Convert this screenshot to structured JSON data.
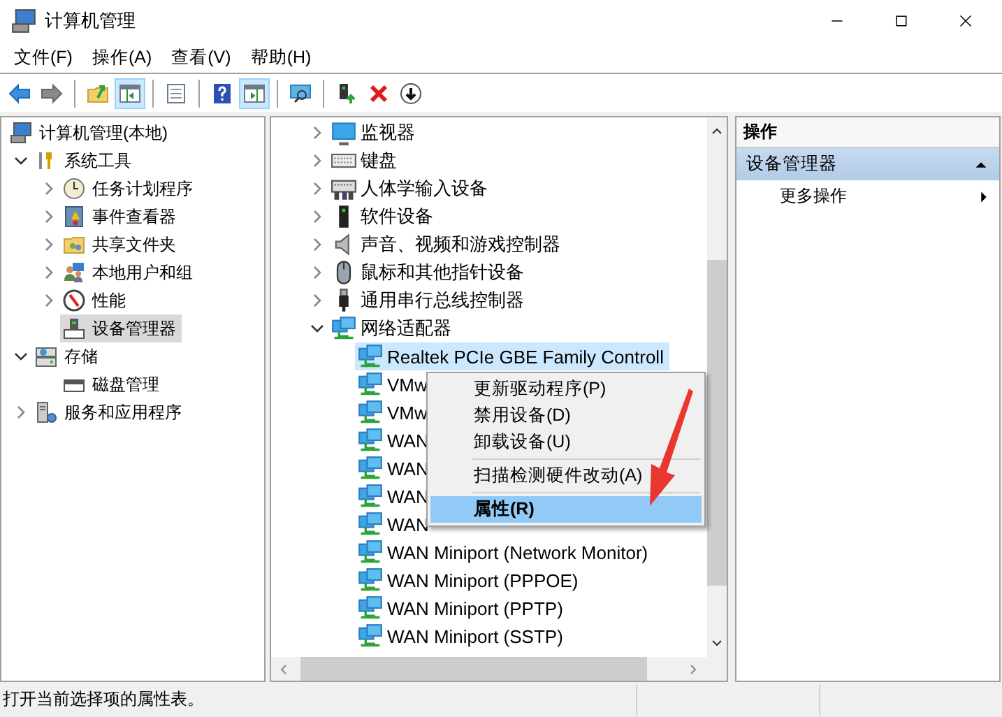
{
  "window": {
    "title": "计算机管理"
  },
  "menu_bar": [
    {
      "label": "文件(F)"
    },
    {
      "label": "操作(A)"
    },
    {
      "label": "查看(V)"
    },
    {
      "label": "帮助(H)"
    }
  ],
  "toolbar": [
    {
      "kind": "button",
      "pressed": false
    },
    {
      "kind": "button",
      "pressed": false
    },
    {
      "kind": "separator"
    },
    {
      "kind": "button",
      "pressed": false
    },
    {
      "kind": "button",
      "pressed": true
    },
    {
      "kind": "separator"
    },
    {
      "kind": "button",
      "pressed": false
    },
    {
      "kind": "separator"
    },
    {
      "kind": "button",
      "pressed": false
    },
    {
      "kind": "button",
      "pressed": true
    },
    {
      "kind": "separator"
    },
    {
      "kind": "button",
      "pressed": false
    },
    {
      "kind": "separator"
    },
    {
      "kind": "button",
      "pressed": false
    },
    {
      "kind": "button",
      "pressed": false
    },
    {
      "kind": "button",
      "pressed": false
    }
  ],
  "tree": {
    "label": "计算机管理(本地)",
    "selected": false,
    "children": [
      {
        "label": "系统工具",
        "expanded": true,
        "selected": false,
        "children": [
          {
            "label": "任务计划程序",
            "expanded": false,
            "selected": false
          },
          {
            "label": "事件查看器",
            "expanded": false,
            "selected": false
          },
          {
            "label": "共享文件夹",
            "expanded": false,
            "selected": false
          },
          {
            "label": "本地用户和组",
            "expanded": false,
            "selected": false
          },
          {
            "label": "性能",
            "expanded": false,
            "selected": false
          },
          {
            "label": "设备管理器",
            "selected": true
          }
        ]
      },
      {
        "label": "存储",
        "expanded": true,
        "selected": false,
        "children": [
          {
            "label": "磁盘管理",
            "selected": false
          }
        ]
      },
      {
        "label": "服务和应用程序",
        "expanded": false,
        "selected": false
      }
    ]
  },
  "devices": [
    {
      "label": "监视器",
      "expanded": false,
      "selected": false
    },
    {
      "label": "键盘",
      "expanded": false,
      "selected": false
    },
    {
      "label": "人体学输入设备",
      "expanded": false,
      "selected": false
    },
    {
      "label": "软件设备",
      "expanded": false,
      "selected": false
    },
    {
      "label": "声音、视频和游戏控制器",
      "expanded": false,
      "selected": false
    },
    {
      "label": "鼠标和其他指针设备",
      "expanded": false,
      "selected": false
    },
    {
      "label": "通用串行总线控制器",
      "expanded": false,
      "selected": false
    },
    {
      "label": "网络适配器",
      "expanded": true,
      "selected": false,
      "children": [
        {
          "label": "Realtek PCIe GBE Family Controll",
          "selected": true
        },
        {
          "label": "VMw",
          "selected": false
        },
        {
          "label": "VMw",
          "selected": false
        },
        {
          "label": "WAN",
          "selected": false
        },
        {
          "label": "WAN",
          "selected": false
        },
        {
          "label": "WAN",
          "selected": false
        },
        {
          "label": "WAN",
          "selected": false
        },
        {
          "label": "WAN Miniport (Network Monitor)",
          "selected": false
        },
        {
          "label": "WAN Miniport (PPPOE)",
          "selected": false
        },
        {
          "label": "WAN Miniport (PPTP)",
          "selected": false
        },
        {
          "label": "WAN Miniport (SSTP)",
          "selected": false
        }
      ]
    }
  ],
  "context_menu": [
    {
      "kind": "item",
      "label": "更新驱动程序(P)",
      "selected": false,
      "default": false
    },
    {
      "kind": "item",
      "label": "禁用设备(D)",
      "selected": false,
      "default": false
    },
    {
      "kind": "item",
      "label": "卸载设备(U)",
      "selected": false,
      "default": false
    },
    {
      "kind": "separator"
    },
    {
      "kind": "item",
      "label": "扫描检测硬件改动(A)",
      "selected": false,
      "default": false
    },
    {
      "kind": "separator"
    },
    {
      "kind": "item",
      "label": "属性(R)",
      "selected": true,
      "default": true
    }
  ],
  "action_pane": {
    "title": "操作",
    "sections": [
      {
        "label": "设备管理器",
        "expanded": true,
        "items": [
          {
            "label": "更多操作"
          }
        ]
      }
    ]
  },
  "status_bar": {
    "text": "打开当前选择项的属性表。"
  }
}
